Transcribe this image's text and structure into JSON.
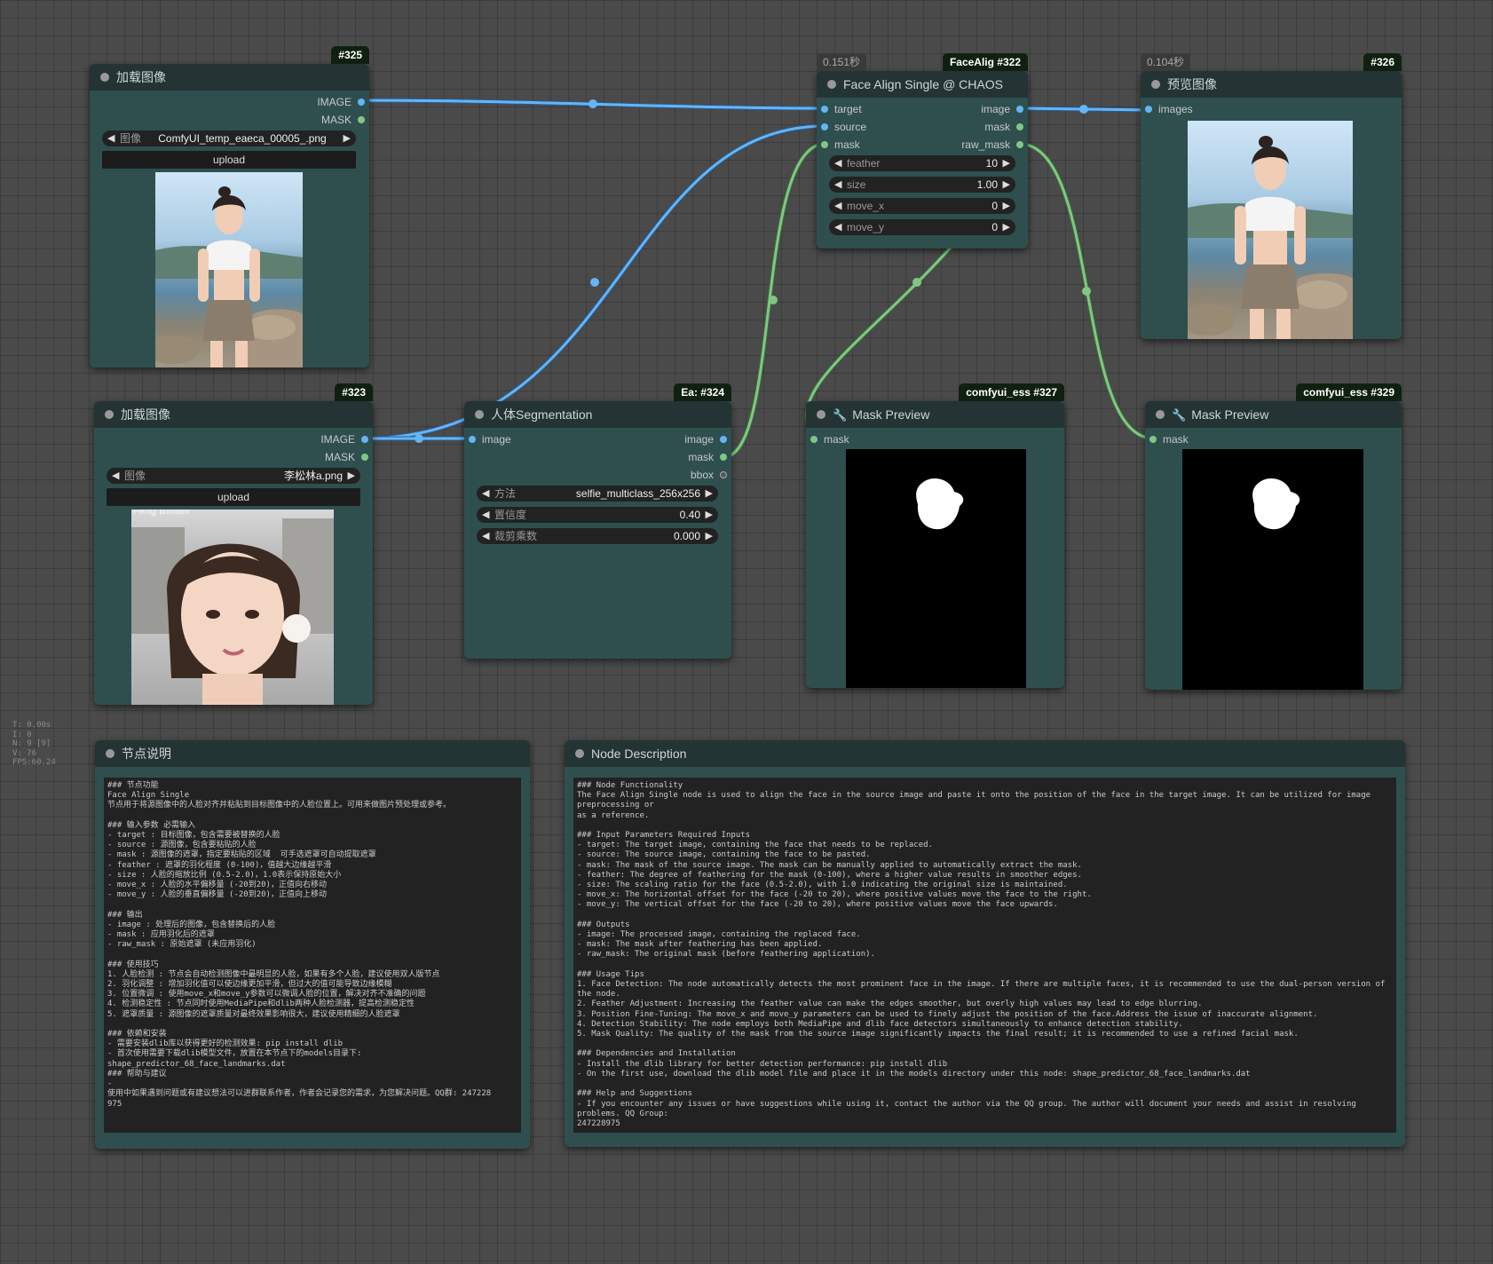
{
  "nodes": {
    "load325": {
      "id": "#325",
      "title": "加载图像",
      "outputs": [
        "IMAGE",
        "MASK"
      ],
      "image_widget": {
        "label": "图像",
        "value": "ComfyUI_temp_eaeca_00005_.png"
      },
      "upload": "upload"
    },
    "load323": {
      "id": "#323",
      "title": "加载图像",
      "outputs": [
        "IMAGE",
        "MASK"
      ],
      "image_widget": {
        "label": "图像",
        "value": "李松林a.png"
      },
      "upload": "upload",
      "photo_watermark": "Feng BiliBili"
    },
    "face322": {
      "id": "#322",
      "title": "Face Align Single @ CHAOS",
      "time": "0.151秒",
      "tag": "FaceAlig",
      "inputs": [
        "target",
        "source",
        "mask"
      ],
      "outputs": [
        "image",
        "mask",
        "raw_mask"
      ],
      "widgets": [
        {
          "label": "feather",
          "value": "10"
        },
        {
          "label": "size",
          "value": "1.00"
        },
        {
          "label": "move_x",
          "value": "0"
        },
        {
          "label": "move_y",
          "value": "0"
        }
      ]
    },
    "preview326": {
      "id": "#326",
      "title": "预览图像",
      "time": "0.104秒",
      "inputs": [
        "images"
      ]
    },
    "seg324": {
      "id": "#324",
      "title": "人体Segmentation",
      "tag": "Ea:",
      "inputs": [
        "image"
      ],
      "outputs": [
        "image",
        "mask",
        "bbox"
      ],
      "widgets": [
        {
          "label": "方法",
          "value": "selfie_multiclass_256x256"
        },
        {
          "label": "置信度",
          "value": "0.40"
        },
        {
          "label": "裁剪乘数",
          "value": "0.000"
        }
      ]
    },
    "mask327": {
      "id": "#327",
      "title": "Mask Preview",
      "tag": "comfyui_ess",
      "inputs": [
        "mask"
      ]
    },
    "mask329": {
      "id": "#329",
      "title": "Mask Preview",
      "tag": "comfyui_ess",
      "inputs": [
        "mask"
      ]
    },
    "desc_cn": {
      "title": "节点说明",
      "text": "### 节点功能\nFace Align Single\n节点用于将源图像中的人脸对齐并粘贴到目标图像中的人脸位置上。可用来做图片预处理或参考。\n\n### 输入参数 必需输入\n- target : 目标图像，包含需要被替换的人脸\n- source : 源图像，包含要粘贴的人脸\n- mask : 源图像的遮罩，指定要粘贴的区域  可手选遮罩可自动提取遮罩\n- feather : 遮罩的羽化程度 (0-100)，值越大边缘越平滑\n- size : 人脸的缩放比例 (0.5-2.0)，1.0表示保持原始大小\n- move_x : 人脸的水平偏移量 (-20到20)，正值向右移动\n- move_y : 人脸的垂直偏移量 (-20到20)，正值向上移动\n\n### 输出\n- image : 处理后的图像，包含替换后的人脸\n- mask : 应用羽化后的遮罩\n- raw_mask : 原始遮罩 (未应用羽化)\n\n### 使用技巧\n1. 人脸检测 : 节点会自动检测图像中最明显的人脸，如果有多个人脸，建议使用双人版节点\n2. 羽化调整 : 增加羽化值可以使边缘更加平滑，但过大的值可能导致边缘模糊\n3. 位置微调 : 使用move_x和move_y参数可以微调人脸的位置，解决对齐不准确的问题\n4. 检测稳定性 : 节点同时使用MediaPipe和dlib两种人脸检测器，提高检测稳定性\n5. 遮罩质量 : 源图像的遮罩质量对最终效果影响很大，建议使用精细的人脸遮罩\n\n### 依赖和安装\n- 需要安装dlib库以获得更好的检测效果: pip install dlib\n- 首次使用需要下载dlib模型文件，放置在本节点下的models目录下:\nshape_predictor_68_face_landmarks.dat\n### 帮助与建议\n-\n使用中如果遇到问题或有建议想法可以进群联系作者，作者会记录您的需求，为您解决问题。QQ群: 247228\n975"
    },
    "desc_en": {
      "title": "Node Description",
      "text": "### Node Functionality\nThe Face Align Single node is used to align the face in the source image and paste it onto the position of the face in the target image. It can be utilized for image preprocessing or\nas a reference.\n\n### Input Parameters Required Inputs\n- target: The target image, containing the face that needs to be replaced.\n- source: The source image, containing the face to be pasted.\n- mask: The mask of the source image. The mask can be manually applied to automatically extract the mask.\n- feather: The degree of feathering for the mask (0-100), where a higher value results in smoother edges.\n- size: The scaling ratio for the face (0.5-2.0), with 1.0 indicating the original size is maintained.\n- move_x: The horizontal offset for the face (-20 to 20), where positive values move the face to the right.\n- move_y: The vertical offset for the face (-20 to 20), where positive values move the face upwards.\n\n### Outputs\n- image: The processed image, containing the replaced face.\n- mask: The mask after feathering has been applied.\n- raw_mask: The original mask (before feathering application).\n\n### Usage Tips\n1. Face Detection: The node automatically detects the most prominent face in the image. If there are multiple faces, it is recommended to use the dual-person version of the node.\n2. Feather Adjustment: Increasing the feather value can make the edges smoother, but overly high values may lead to edge blurring.\n3. Position Fine-Tuning: The move_x and move_y parameters can be used to finely adjust the position of the face.Address the issue of inaccurate alignment.\n4. Detection Stability: The node employs both MediaPipe and dlib face detectors simultaneously to enhance detection stability.\n5. Mask Quality: The quality of the mask from the source image significantly impacts the final result; it is recommended to use a refined facial mask.\n\n### Dependencies and Installation\n- Install the dlib library for better detection performance: pip install dlib\n- On the first use, download the dlib model file and place it in the models directory under this node: shape_predictor_68_face_landmarks.dat\n\n### Help and Suggestions\n- If you encounter any issues or have suggestions while using it, contact the author via the QQ group. The author will document your needs and assist in resolving problems. QQ Group:\n247228975"
    }
  },
  "stats": [
    "T: 0.00s",
    "I: 0",
    "N: 9 [9]",
    "V: 76",
    "FPS:60.24"
  ],
  "colors": {
    "image_wire": "#64b5f6",
    "mask_wire": "#81c784",
    "node_bg": "#2f4f4f",
    "title_bg": "#243434"
  }
}
